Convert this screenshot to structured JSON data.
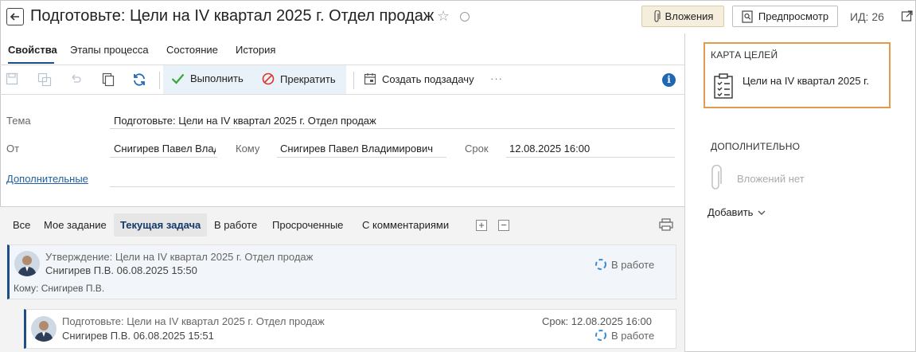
{
  "header": {
    "title": "Подготовьте: Цели на IV квартал 2025 г. Отдел продаж",
    "attachments_label": "Вложения",
    "preview_label": "Предпросмотр",
    "id_label": "ИД: 26"
  },
  "tabs": [
    "Свойства",
    "Этапы процесса",
    "Состояние",
    "История"
  ],
  "toolbar": {
    "execute_label": "Выполнить",
    "stop_label": "Прекратить",
    "create_subtask_label": "Создать подзадачу",
    "more_label": "···"
  },
  "form": {
    "subject_label": "Тема",
    "subject_value": "Подготовьте: Цели на IV квартал 2025 г. Отдел продаж",
    "from_label": "От",
    "from_value": "Снигирев Павел Владимирович",
    "to_label": "Кому",
    "to_value": "Снигирев Павел Владимирович",
    "deadline_label": "Срок",
    "deadline_value": "12.08.2025 16:00",
    "additional_link": "Дополнительные"
  },
  "filters": [
    "Все",
    "Мое задание",
    "Текущая задача",
    "В работе",
    "Просроченные",
    "С комментариями"
  ],
  "filter_buttons": {
    "expand": "+",
    "collapse": "−"
  },
  "tasks": [
    {
      "title": "Утверждение: Цели на IV квартал 2025 г. Отдел продаж",
      "meta": "Снигирев П.В.   06.08.2025 15:50",
      "to": "Кому: Снигирев П.В.",
      "status": "В работе"
    },
    {
      "title": "Подготовьте: Цели на IV квартал 2025 г. Отдел продаж",
      "meta": "Снигирев П.В.   06.08.2025 15:51",
      "deadline": "Срок: 12.08.2025 16:00",
      "status": "В работе"
    }
  ],
  "right_panel": {
    "goals_title": "КАРТА ЦЕЛЕЙ",
    "goal_item": "Цели на IV квартал 2025 г.",
    "extra_title": "ДОПОЛНИТЕЛЬНО",
    "no_attachments": "Вложений нет",
    "add_label": "Добавить"
  },
  "colors": {
    "accent": "#1a4f8a",
    "highlight_border": "#e39a4c",
    "attach_bg": "#f5eedd",
    "info": "#1f66b3"
  }
}
